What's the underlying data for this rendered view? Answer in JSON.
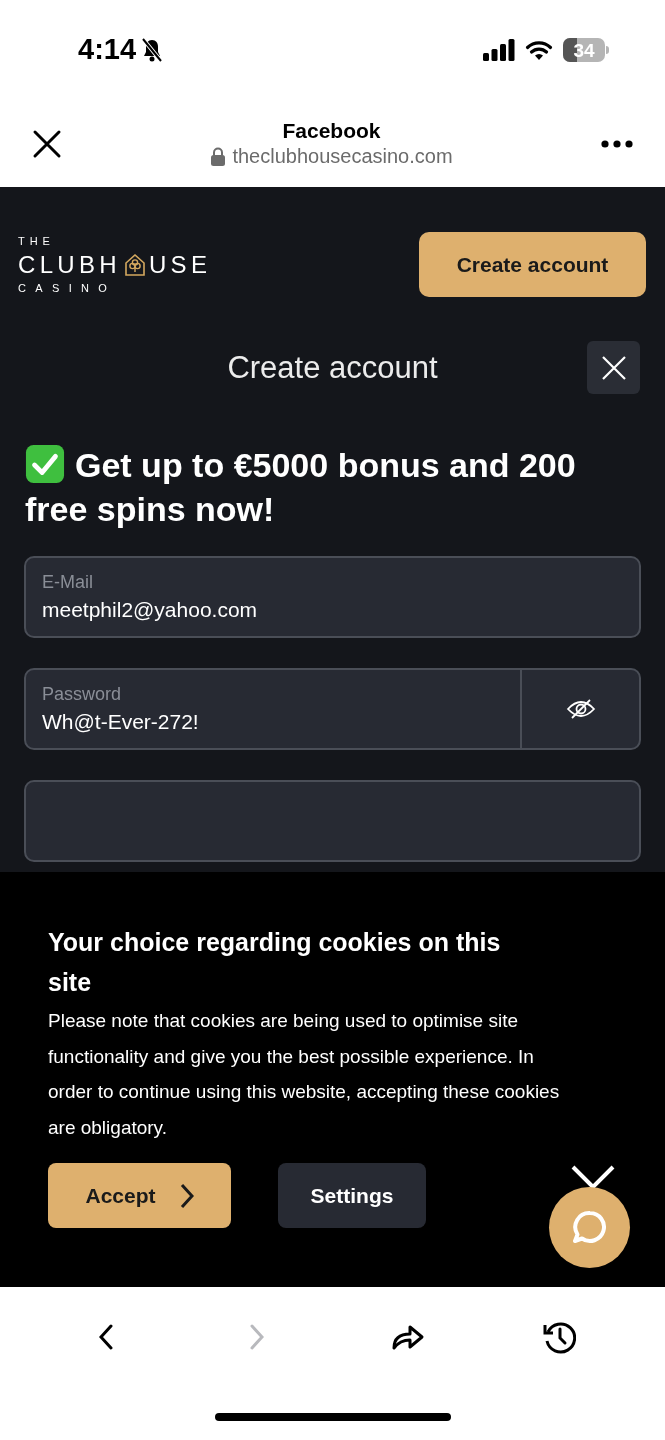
{
  "status_bar": {
    "time": "4:14",
    "battery": "34"
  },
  "browser": {
    "title": "Facebook",
    "url": "theclubhousecasino.com"
  },
  "site": {
    "logo": {
      "top": "THE",
      "main_left": "CLUBH",
      "main_right": "USE",
      "bottom": "CASINO"
    },
    "header_button": "Create account"
  },
  "modal": {
    "title": "Create account",
    "headline": "Get up to €5000 bonus and 200 free spins now!",
    "fields": [
      {
        "kind": "text",
        "label": "E-Mail",
        "value": "meetphil2@yahoo.com"
      },
      {
        "kind": "password",
        "label": "Password",
        "value": "Wh@t-Ever-272!"
      },
      {
        "kind": "empty"
      }
    ]
  },
  "cookie_banner": {
    "title": "Your choice regarding cookies on this site",
    "body": "Please note that cookies are being used to optimise site functionality and give you the best possible experience. In order to continue using this website, accepting these cookies are obligatory.",
    "buttons": [
      {
        "kind": "primary",
        "label": "Accept"
      },
      {
        "kind": "secondary",
        "label": "Settings"
      }
    ]
  },
  "toolbar": [
    {
      "kind": "back",
      "disabled": false
    },
    {
      "kind": "forward",
      "disabled": true
    },
    {
      "kind": "share",
      "disabled": false
    },
    {
      "kind": "history",
      "disabled": false
    }
  ]
}
